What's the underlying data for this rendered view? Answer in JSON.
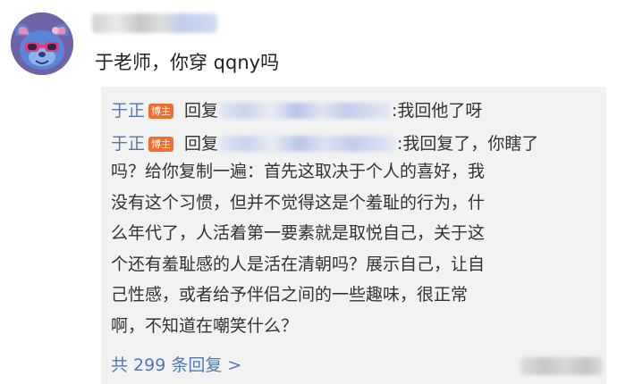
{
  "comment": {
    "text": "于老师，你穿 qqny吗",
    "avatar_icon": "cartoon-stitch-avatar-icon"
  },
  "replies": [
    {
      "author": "于正",
      "badge": "博主",
      "reply_prefix": "回复",
      "text": ":我回他了呀"
    },
    {
      "author": "于正",
      "badge": "博主",
      "reply_prefix": "回复",
      "first_line": ":我回复了，你瞎了",
      "lines": [
        "吗？给你复制一遍：首先这取决于个人的喜好，我",
        "没有这个习惯，但并不觉得这是个羞耻的行为，什",
        "么年代了，人活着第一要素就是取悦自己，关于这",
        "个还有羞耻感的人是活在清朝吗？展示自己，让自",
        "己性感，或者给予伴侣之间的一些趣味，很正常",
        "啊，不知道在嘲笑什么？"
      ]
    }
  ],
  "more_replies": "共 299 条回复 >",
  "colors": {
    "link": "#4f78b5",
    "badge": "#f06e2d",
    "reply_bg": "#f2f2f2"
  }
}
